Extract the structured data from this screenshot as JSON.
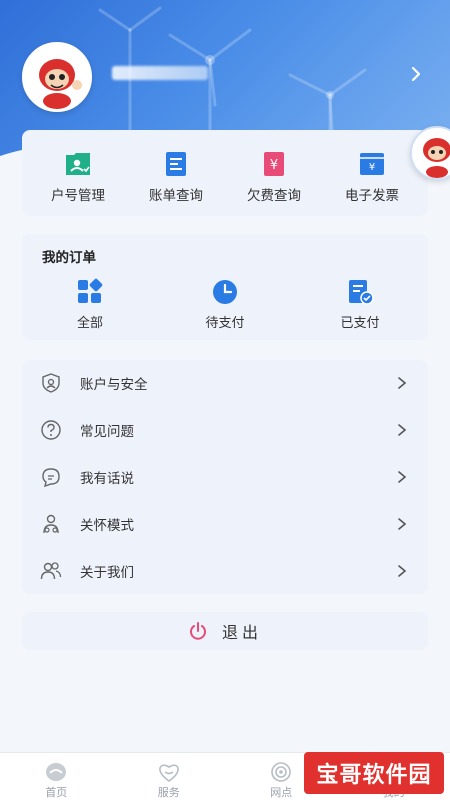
{
  "profile": {
    "username": ""
  },
  "quick_actions": [
    {
      "label": "户号管理",
      "icon": "account-id-icon",
      "color": "#1fb08a"
    },
    {
      "label": "账单查询",
      "icon": "bill-icon",
      "color": "#2a7be4"
    },
    {
      "label": "欠费查询",
      "icon": "arrears-icon",
      "color": "#e84b78"
    },
    {
      "label": "电子发票",
      "icon": "invoice-icon",
      "color": "#2a7be4"
    }
  ],
  "orders": {
    "title": "我的订单",
    "items": [
      {
        "label": "全部",
        "icon": "grid-icon"
      },
      {
        "label": "待支付",
        "icon": "clock-icon"
      },
      {
        "label": "已支付",
        "icon": "paid-doc-icon"
      }
    ]
  },
  "menu": [
    {
      "label": "账户与安全",
      "icon": "shield-user-icon"
    },
    {
      "label": "常见问题",
      "icon": "question-icon"
    },
    {
      "label": "我有话说",
      "icon": "chat-icon"
    },
    {
      "label": "关怀模式",
      "icon": "care-icon"
    },
    {
      "label": "关于我们",
      "icon": "people-icon"
    }
  ],
  "logout": {
    "label": "退出",
    "color": "#e84b78"
  },
  "bottom_nav": [
    {
      "label": "首页"
    },
    {
      "label": "服务"
    },
    {
      "label": "网点"
    },
    {
      "label": "我的"
    }
  ],
  "watermark": {
    "text": "宝哥软件园"
  },
  "colors": {
    "accent": "#2a7be4",
    "header": "#3b7fe0"
  }
}
